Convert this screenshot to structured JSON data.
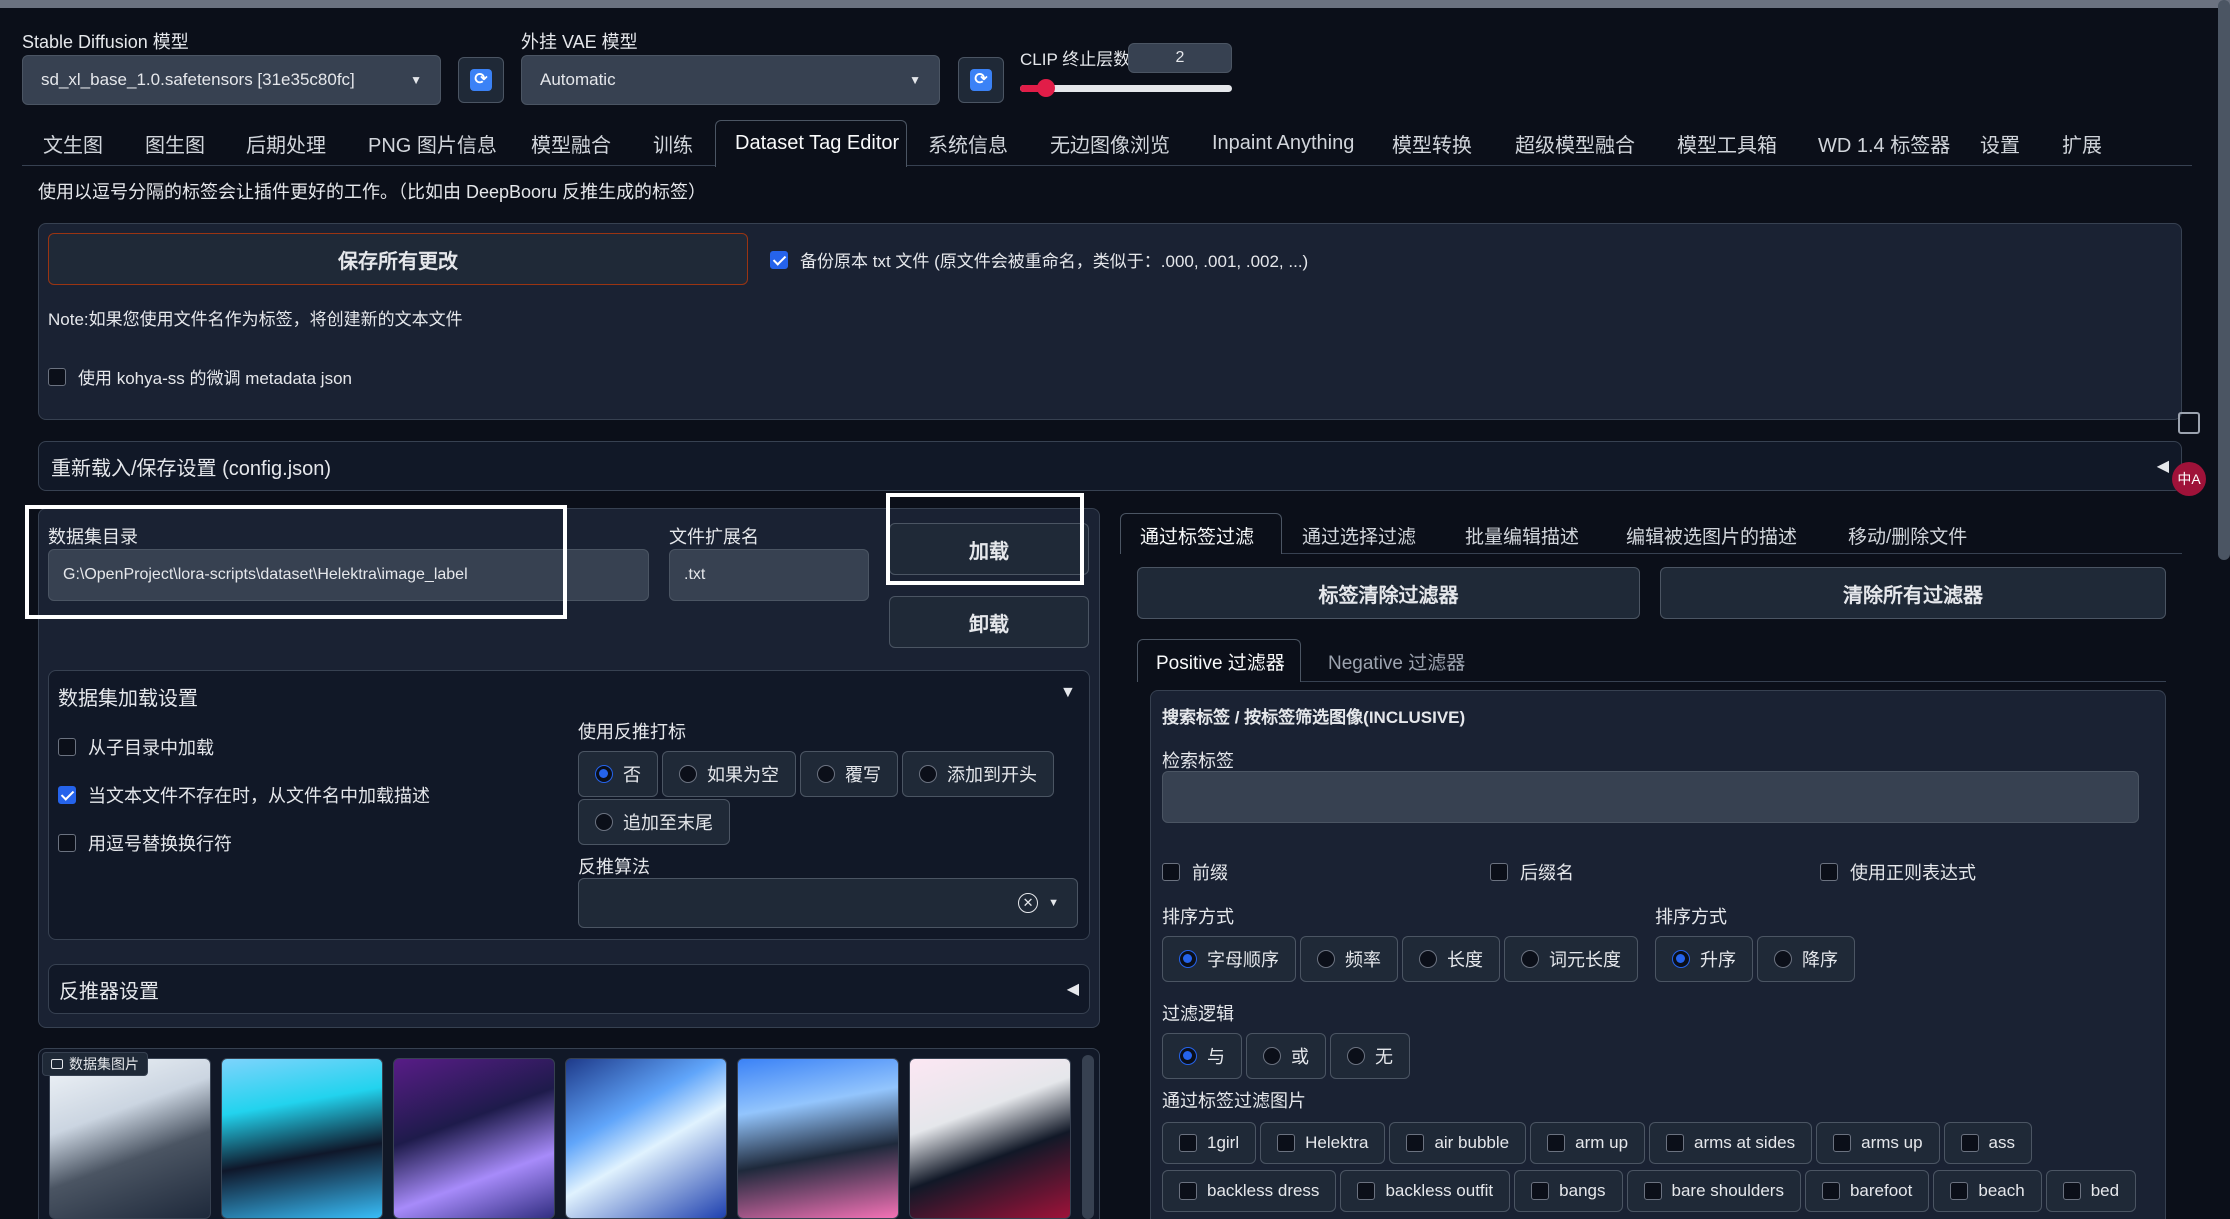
{
  "top": {
    "sd_model_label": "Stable Diffusion 模型",
    "sd_model_value": "sd_xl_base_1.0.safetensors [31e35c80fc]",
    "vae_label": "外挂 VAE 模型",
    "vae_value": "Automatic",
    "clip_label": "CLIP 终止层数",
    "clip_value": "2"
  },
  "tabs": [
    "文生图",
    "图生图",
    "后期处理",
    "PNG 图片信息",
    "模型融合",
    "训练",
    "Dataset Tag Editor",
    "系统信息",
    "无边图像浏览",
    "Inpaint Anything",
    "模型转换",
    "超级模型融合",
    "模型工具箱",
    "WD 1.4 标签器",
    "设置",
    "扩展"
  ],
  "intro": "使用以逗号分隔的标签会让插件更好的工作。（比如由 DeepBooru 反推生成的标签）",
  "save": {
    "button": "保存所有更改",
    "backup_label": "备份原本 txt 文件 (原文件会被重命名，类似于：.000, .001, .002, ...)",
    "note": "Note:如果您使用文件名作为标签，将创建新的文本文件",
    "kohya_label": "使用 kohya-ss 的微调 metadata json"
  },
  "config_accordion": "重新载入/保存设置 (config.json)",
  "dataset": {
    "dir_label": "数据集目录",
    "dir_value": "G:\\OpenProject\\lora-scripts\\dataset\\Helektra\\image_label",
    "ext_label": "文件扩展名",
    "ext_value": ".txt",
    "load_button": "加载",
    "unload_button": "卸载"
  },
  "load_settings": {
    "title": "数据集加载设置",
    "subdir": "从子目录中加载",
    "from_filename": "当文本文件不存在时，从文件名中加载描述",
    "comma": "用逗号替换换行符",
    "interrogate_label": "使用反推打标",
    "interrogate_options": [
      "否",
      "如果为空",
      "覆写",
      "添加到开头",
      "追加至末尾"
    ],
    "algo_label": "反推算法"
  },
  "interrogator_accordion": "反推器设置",
  "gallery_label": "数据集图片",
  "right_tabs": [
    "通过标签过滤",
    "通过选择过滤",
    "批量编辑描述",
    "编辑被选图片的描述",
    "移动/删除文件"
  ],
  "filter": {
    "clear_tag_filter": "标签清除过滤器",
    "clear_all_filters": "清除所有过滤器",
    "pos_tab": "Positive 过滤器",
    "neg_tab": "Negative 过滤器",
    "section_title": "搜索标签 / 按标签筛选图像(INCLUSIVE)",
    "search_label": "检索标签",
    "prefix": "前缀",
    "suffix": "后缀名",
    "regex": "使用正则表达式",
    "sort_label": "排序方式",
    "sort_options": [
      "字母顺序",
      "频率",
      "长度",
      "词元长度"
    ],
    "order_label": "排序方式",
    "order_options": [
      "升序",
      "降序"
    ],
    "logic_label": "过滤逻辑",
    "logic_options": [
      "与",
      "或",
      "无"
    ],
    "tags_label": "通过标签过滤图片",
    "tags_row1": [
      "1girl",
      "Helektra",
      "air bubble",
      "arm up",
      "arms at sides",
      "arms up",
      "ass"
    ],
    "tags_row2": [
      "backless dress",
      "backless outfit",
      "bangs",
      "bare shoulders",
      "barefoot",
      "beach",
      "bed"
    ]
  },
  "colors": {
    "accent": "#2563eb",
    "background": "#0b0f19",
    "panel": "#1f2937",
    "highlight_box": "#ffffff",
    "slider": "#e11d48"
  }
}
